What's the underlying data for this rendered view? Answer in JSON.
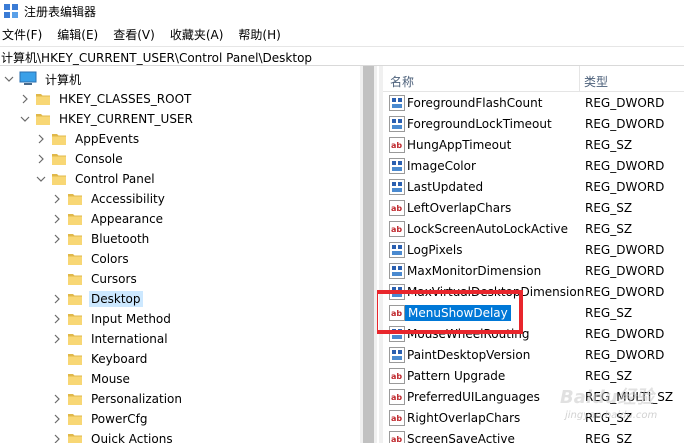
{
  "window": {
    "title": "注册表编辑器"
  },
  "menu": {
    "items": [
      "文件(F)",
      "编辑(E)",
      "查看(V)",
      "收藏夹(A)",
      "帮助(H)"
    ]
  },
  "address": {
    "path": "计算机\\HKEY_CURRENT_USER\\Control Panel\\Desktop"
  },
  "tree": {
    "computer": "计算机",
    "hkcr": "HKEY_CLASSES_ROOT",
    "hkcu": "HKEY_CURRENT_USER",
    "appevents": "AppEvents",
    "console": "Console",
    "control_panel": "Control Panel",
    "children": [
      "Accessibility",
      "Appearance",
      "Bluetooth",
      "Colors",
      "Cursors",
      "Desktop",
      "Input Method",
      "International",
      "Keyboard",
      "Mouse",
      "Personalization",
      "PowerCfg",
      "Quick Actions"
    ],
    "selected": "Desktop"
  },
  "list": {
    "col_name": "名称",
    "col_type": "类型",
    "rows": [
      {
        "name": "ForegroundFlashCount",
        "type": "REG_DWORD",
        "icon": "dword-value-icon"
      },
      {
        "name": "ForegroundLockTimeout",
        "type": "REG_DWORD",
        "icon": "dword-value-icon"
      },
      {
        "name": "HungAppTimeout",
        "type": "REG_SZ",
        "icon": "string-value-icon"
      },
      {
        "name": "ImageColor",
        "type": "REG_DWORD",
        "icon": "dword-value-icon"
      },
      {
        "name": "LastUpdated",
        "type": "REG_DWORD",
        "icon": "dword-value-icon"
      },
      {
        "name": "LeftOverlapChars",
        "type": "REG_SZ",
        "icon": "string-value-icon"
      },
      {
        "name": "LockScreenAutoLockActive",
        "type": "REG_SZ",
        "icon": "string-value-icon"
      },
      {
        "name": "LogPixels",
        "type": "REG_DWORD",
        "icon": "dword-value-icon"
      },
      {
        "name": "MaxMonitorDimension",
        "type": "REG_DWORD",
        "icon": "dword-value-icon"
      },
      {
        "name": "MaxVirtualDesktopDimension",
        "type": "REG_DWORD",
        "icon": "dword-value-icon"
      },
      {
        "name": "MenuShowDelay",
        "type": "REG_SZ",
        "icon": "string-value-icon"
      },
      {
        "name": "MouseWheelRouting",
        "type": "REG_DWORD",
        "icon": "dword-value-icon"
      },
      {
        "name": "PaintDesktopVersion",
        "type": "REG_DWORD",
        "icon": "dword-value-icon"
      },
      {
        "name": "Pattern Upgrade",
        "type": "REG_SZ",
        "icon": "string-value-icon"
      },
      {
        "name": "PreferredUILanguages",
        "type": "REG_MULTI_SZ",
        "icon": "string-value-icon"
      },
      {
        "name": "RightOverlapChars",
        "type": "REG_SZ",
        "icon": "string-value-icon"
      },
      {
        "name": "ScreenSaveActive",
        "type": "REG_SZ",
        "icon": "string-value-icon"
      }
    ],
    "selected": "MenuShowDelay"
  },
  "watermark": {
    "text": "Baidu经验",
    "sub": "jingyan.baidu.com"
  },
  "colors": {
    "selection": "#0078d7",
    "tree_selection": "#cce8ff",
    "annotation": "#e8262c",
    "folder": "#f8d775"
  }
}
